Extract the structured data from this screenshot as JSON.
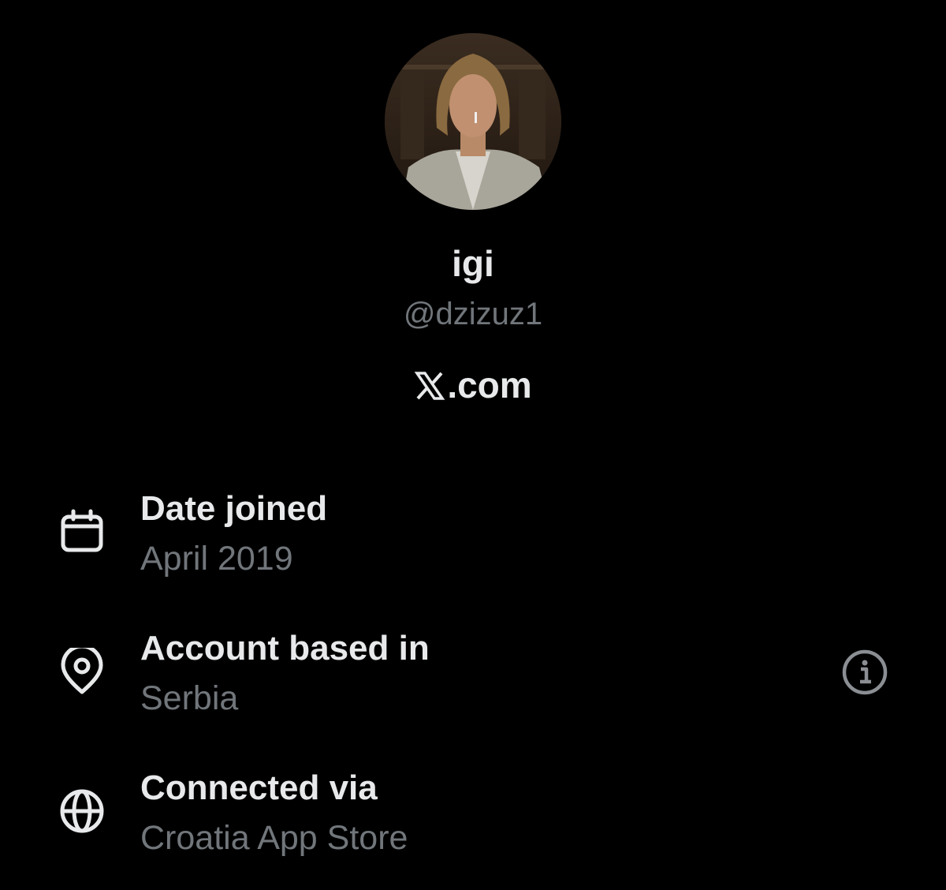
{
  "profile": {
    "display_name": "igi",
    "handle": "@dzizuz1",
    "platform_logo_glyph": "𝕏",
    "platform_text": ".com"
  },
  "details": [
    {
      "icon": "calendar-icon",
      "label": "Date joined",
      "value": "April 2019"
    },
    {
      "icon": "location-pin-icon",
      "label": "Account based in",
      "value": "Serbia"
    },
    {
      "icon": "globe-icon",
      "label": "Connected via",
      "value": "Croatia App Store"
    }
  ],
  "colors": {
    "background": "#000000",
    "primary_text": "#e7e9ea",
    "secondary_text": "#71767b"
  }
}
